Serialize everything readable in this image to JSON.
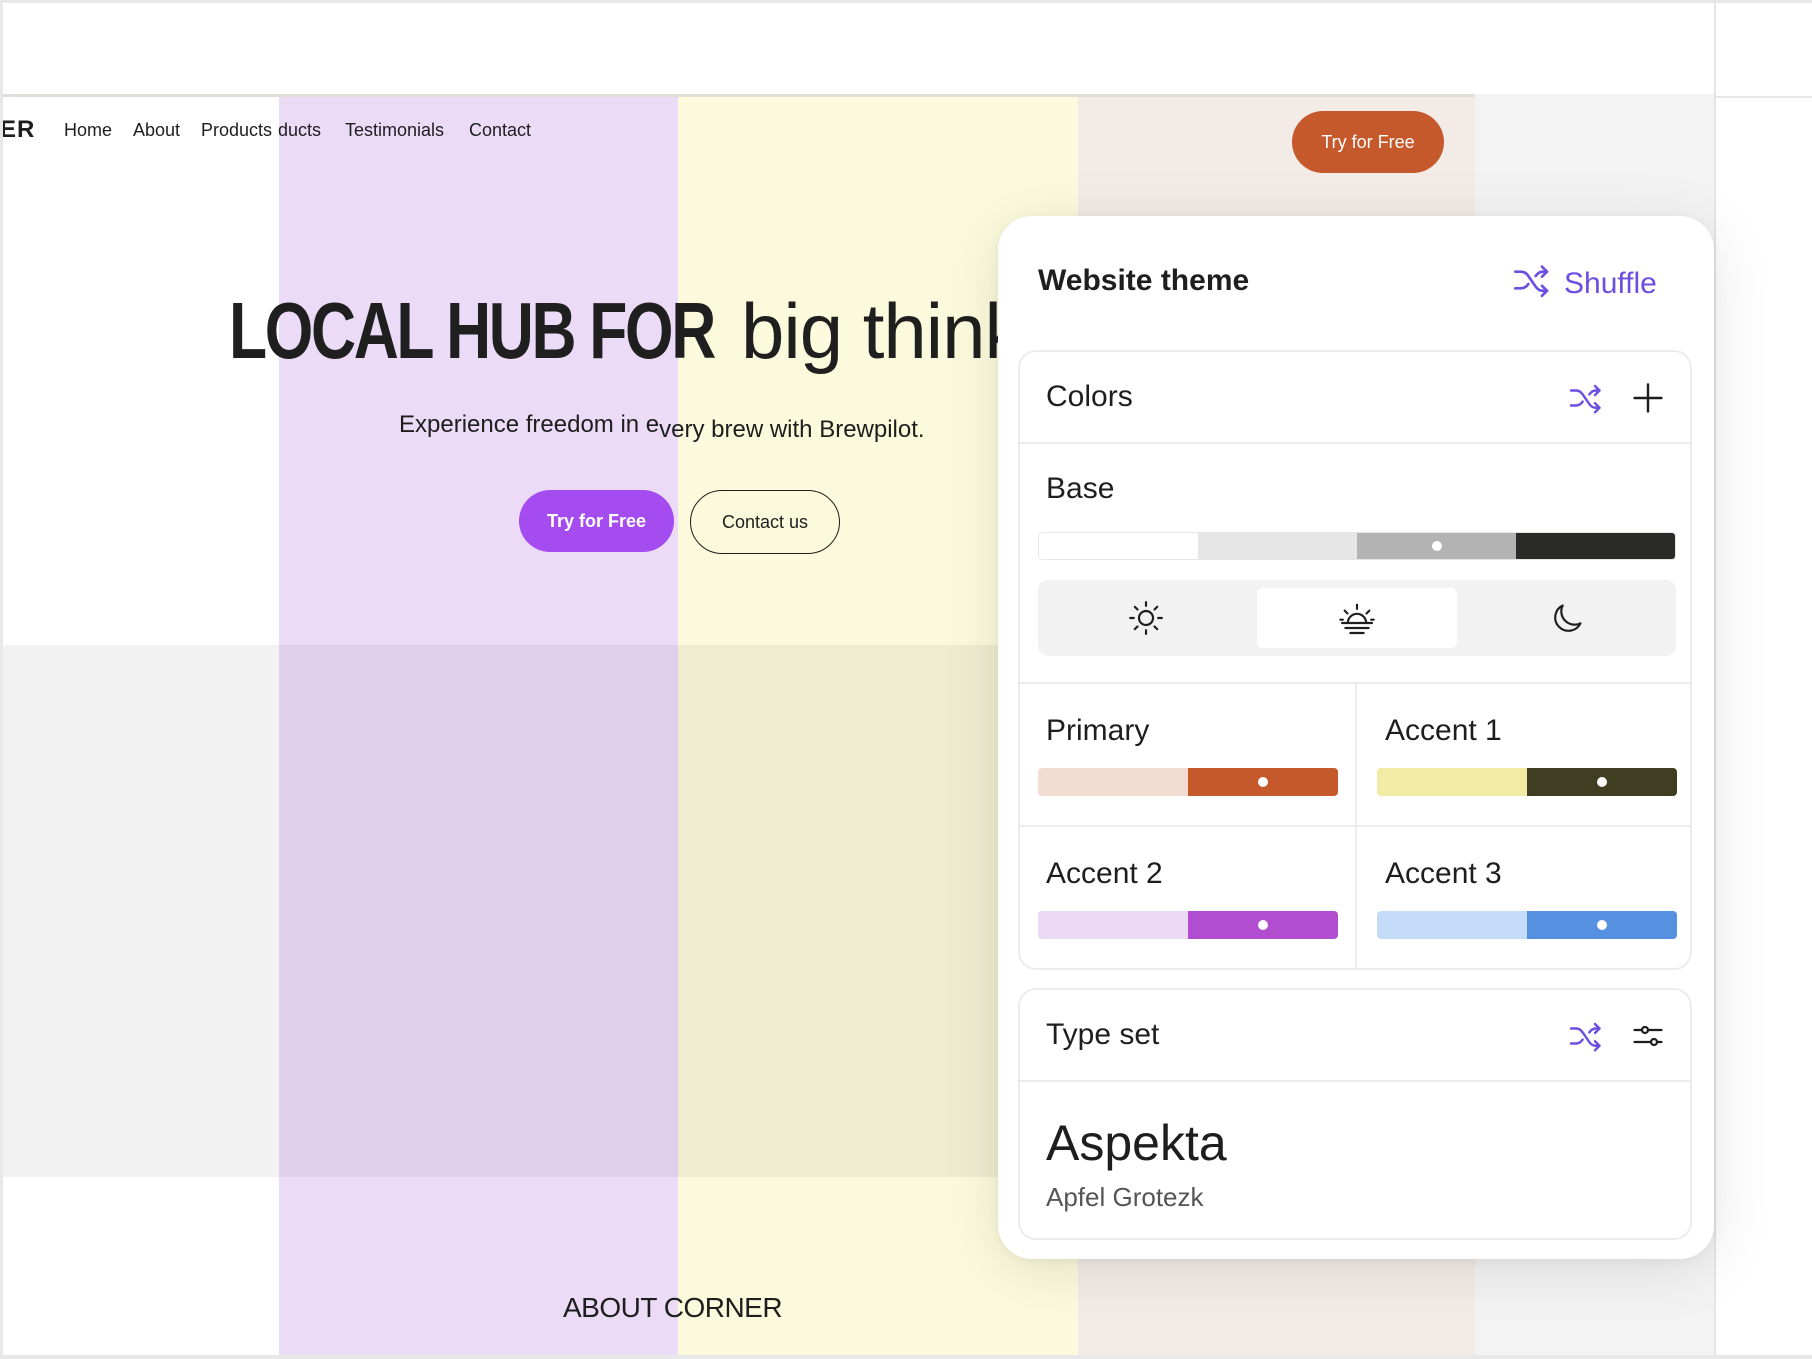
{
  "site": {
    "nav": {
      "logo": "ER",
      "links": [
        "Home",
        "About",
        "Products",
        "ducts",
        "Testimonials",
        "Contact"
      ],
      "cta": "Try for Free"
    },
    "hero": {
      "title_bold": "LOCAL HUB FOR",
      "title_light": "big think",
      "subtitle_a": "Experience freedom in e",
      "subtitle_b": "very brew with Brewpilot.",
      "primary_button": "Try for Free",
      "secondary_button": "Contact us"
    },
    "section_heading": "ABOUT CORNER",
    "colors": {
      "band_purple": "#ebdbf7",
      "band_yellow": "#fcfadc",
      "band_beige": "#f3ebe6",
      "nav_cta": "#c5592c",
      "hero_primary": "#a54cf0"
    }
  },
  "panel": {
    "title": "Website theme",
    "shuffle_label": "Shuffle",
    "shuffle_icon": "shuffle-icon",
    "accent": "#6a4fe0",
    "colors": {
      "label": "Colors",
      "base": {
        "label": "Base",
        "swatches": [
          "#ffffff",
          "#e6e6e6",
          "#b3b3b3",
          "#2a2a28"
        ],
        "selected_index": 2
      },
      "mode": {
        "options": [
          "light-mode-icon",
          "sunset-mode-icon",
          "dark-mode-icon"
        ],
        "selected_index": 1
      },
      "palettes": [
        {
          "label": "Primary",
          "light": "#f3ddd3",
          "dark": "#c5592c"
        },
        {
          "label": "Accent 1",
          "light": "#f1eba6",
          "dark": "#3f3d22"
        },
        {
          "label": "Accent 2",
          "light": "#ecd9f5",
          "dark": "#b14ed0"
        },
        {
          "label": "Accent 3",
          "light": "#c5dcf8",
          "dark": "#5690e0"
        }
      ]
    },
    "type_set": {
      "label": "Type set",
      "heading_font": "Aspekta",
      "body_font": "Apfel Grotezk"
    }
  }
}
